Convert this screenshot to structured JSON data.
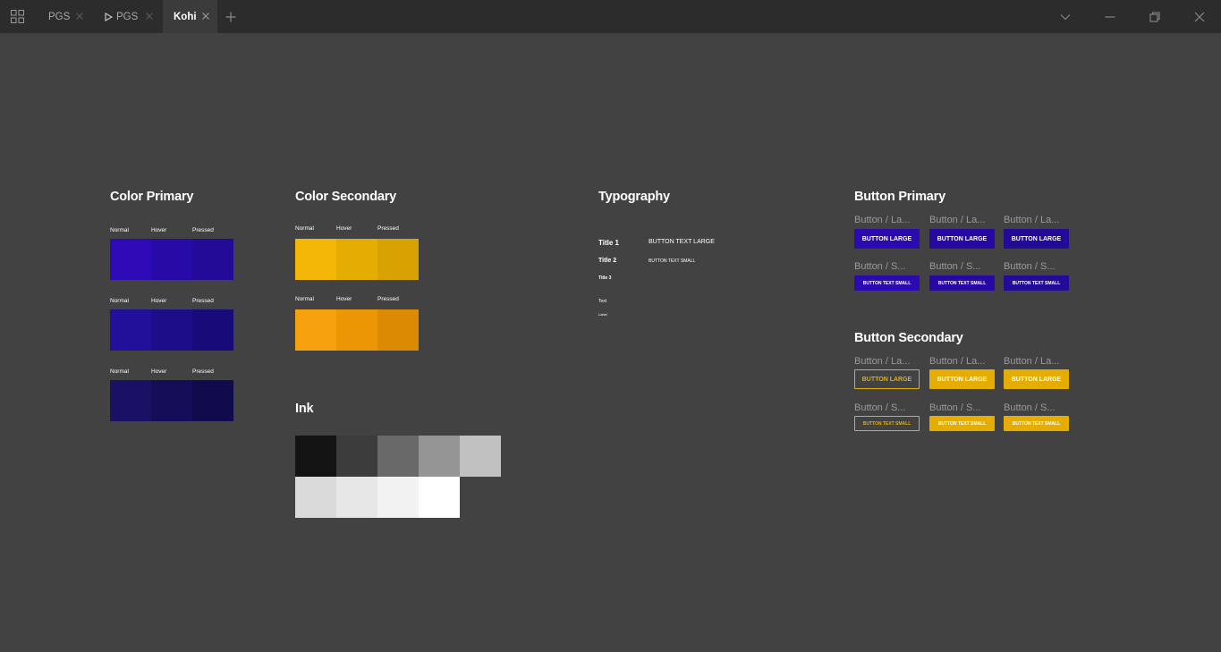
{
  "titlebar": {
    "tabs": [
      {
        "label": "PGS",
        "active": false,
        "playing": false
      },
      {
        "label": "PGS",
        "active": false,
        "playing": true
      },
      {
        "label": "Kohi",
        "active": true,
        "playing": false
      }
    ],
    "new_tab_icon": "plus-icon",
    "controls": [
      "chevron-down-icon",
      "minimize-icon",
      "restore-icon",
      "close-icon"
    ]
  },
  "color_primary": {
    "title": "Color Primary",
    "states": [
      "Normal",
      "Hover",
      "Pressed"
    ],
    "rows": [
      [
        "#2e0bb7",
        "#280ba6",
        "#230a97"
      ],
      [
        "#23109a",
        "#1e0d89",
        "#190a7a"
      ],
      [
        "#1a1165",
        "#150d58",
        "#110a4d"
      ]
    ]
  },
  "color_secondary": {
    "title": "Color Secondary",
    "states": [
      "Normal",
      "Hover",
      "Pressed"
    ],
    "rows": [
      [
        "#f4b708",
        "#e5ad02",
        "#d8a202"
      ],
      [
        "#f6a10d",
        "#ec9505",
        "#dc8a03"
      ]
    ]
  },
  "ink": {
    "title": "Ink",
    "rows": [
      [
        "#141414",
        "#3c3c3c",
        "#696969",
        "#959595",
        "#c1c1c1"
      ],
      [
        "#dadada",
        "#e7e7e7",
        "#f2f2f2",
        "#ffffff"
      ]
    ]
  },
  "typography": {
    "title": "Typography",
    "title1": "Title 1",
    "title2": "Title 2",
    "title3": "Title 3",
    "text": "Text",
    "label": "Label",
    "button_large": "BUTTON TEXT LARGE",
    "button_small": "BUTTON TEXT SMALL"
  },
  "button_primary": {
    "title": "Button Primary",
    "label_large": "Button / La...",
    "label_small": "Button / S...",
    "text_large": "BUTTON LARGE",
    "text_small": "BUTTON TEXT SMALL",
    "colors": [
      "#2b0bb0",
      "#2808a4",
      "#230a97"
    ]
  },
  "button_secondary": {
    "title": "Button Secondary",
    "label_large": "Button / La...",
    "label_small": "Button / S...",
    "text_large": "BUTTON LARGE",
    "text_small": "BUTTON TEXT SMALL",
    "accent": "#e5ad02"
  }
}
